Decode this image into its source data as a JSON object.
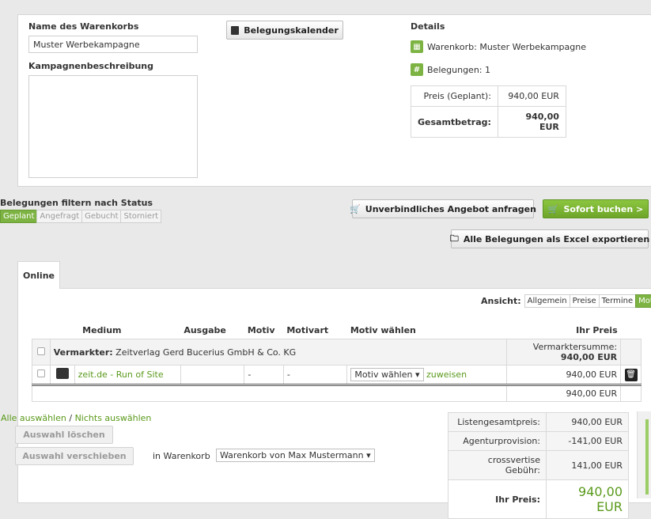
{
  "basket": {
    "name_label": "Name des Warenkorbs",
    "name_value": "Muster Werbekampagne",
    "description_label": "Kampagnenbeschreibung",
    "description_value": "",
    "calendar_button": "Belegungskalender"
  },
  "details": {
    "title": "Details",
    "basket_line": "Warenkorb: Muster Werbekampagne",
    "bookings_line": "Belegungen: 1",
    "price_planned_label": "Preis (Geplant):",
    "price_planned_value": "940,00 EUR",
    "total_label": "Gesamtbetrag:",
    "total_value": "940,00 EUR"
  },
  "filter": {
    "label": "Belegungen filtern nach Status",
    "options": [
      "Geplant",
      "Angefragt",
      "Gebucht",
      "Storniert"
    ],
    "active": "Geplant"
  },
  "actions": {
    "offer_button": "Unverbindliches Angebot anfragen",
    "book_button": "Sofort buchen >",
    "export_button": "Alle Belegungen als Excel exportieren"
  },
  "tabs": {
    "online": "Online"
  },
  "view": {
    "label": "Ansicht:",
    "options": [
      "Allgemein",
      "Preise",
      "Termine",
      "Motive"
    ],
    "active": "Motive"
  },
  "table": {
    "headers": [
      "Medium",
      "Ausgabe",
      "Motiv",
      "Motivart",
      "Motiv wählen",
      "Ihr Preis"
    ],
    "vendor_label": "Vermarkter:",
    "vendor_name": "Zeitverlag Gerd Bucerius GmbH & Co. KG",
    "vendor_sum_label": "Vermarktersumme:",
    "vendor_sum_value": "940,00 EUR",
    "row": {
      "medium": "zeit.de - Run of Site",
      "ausgabe": "",
      "motiv": "-",
      "motivart": "-",
      "motiv_select": "Motiv wählen",
      "assign_link": "zuweisen",
      "price": "940,00 EUR"
    },
    "subtotal": "940,00 EUR"
  },
  "selection": {
    "select_all": "Alle auswählen",
    "separator": "/",
    "select_none": "Nichts auswählen",
    "delete_button": "Auswahl löschen",
    "move_button": "Auswahl verschieben",
    "in_basket_label": "in Warenkorb",
    "basket_select": "Warenkorb von Max Mustermann"
  },
  "summary": {
    "list_total_label": "Listengesamtpreis:",
    "list_total_value": "940,00 EUR",
    "agency_label": "Agenturprovision:",
    "agency_value": "-141,00 EUR",
    "fee_label": "crossvertise Gebühr:",
    "fee_value": "141,00 EUR",
    "your_price_label": "Ihr Preis:",
    "your_price_value": "940,00 EUR"
  },
  "colors": {
    "accent": "#7cb342",
    "link": "#5a9a1b"
  }
}
